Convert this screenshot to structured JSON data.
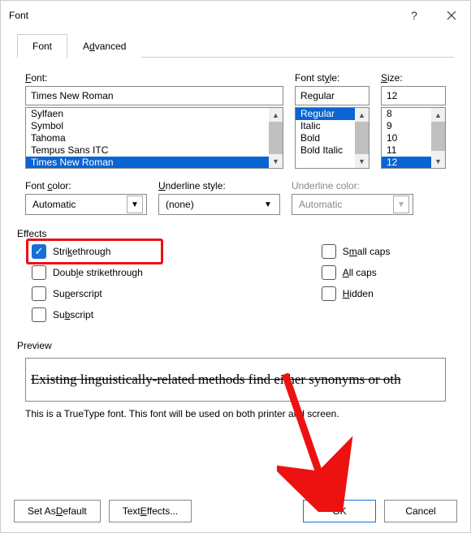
{
  "window": {
    "title": "Font"
  },
  "tabs": {
    "font": "Font",
    "advanced": "Advanced"
  },
  "labels": {
    "font": "Font:",
    "style": "Font style:",
    "size": "Size:",
    "fontColor": "Font color:",
    "underlineStyle": "Underline style:",
    "underlineColor": "Underline color:",
    "effects": "Effects",
    "preview": "Preview"
  },
  "font": {
    "value": "Times New Roman",
    "list": [
      "Sylfaen",
      "Symbol",
      "Tahoma",
      "Tempus Sans ITC",
      "Times New Roman"
    ],
    "selected": "Times New Roman"
  },
  "style": {
    "value": "Regular",
    "list": [
      "Regular",
      "Italic",
      "Bold",
      "Bold Italic"
    ],
    "selected": "Regular"
  },
  "size": {
    "value": "12",
    "list": [
      "8",
      "9",
      "10",
      "11",
      "12"
    ],
    "selected": "12"
  },
  "combos": {
    "fontColor": "Automatic",
    "underlineStyle": "(none)",
    "underlineColor": "Automatic"
  },
  "effects": {
    "strikethrough": "Strikethrough",
    "doubleStrike": "Double strikethrough",
    "superscript": "Superscript",
    "subscript": "Subscript",
    "smallCaps": "Small caps",
    "allCaps": "All caps",
    "hidden": "Hidden"
  },
  "preview": {
    "text": "Existing linguistically-related methods find either synonyms or oth",
    "desc": "This is a TrueType font. This font will be used on both printer and screen."
  },
  "buttons": {
    "setDefault": "Set As Default",
    "textEffects": "Text Effects...",
    "ok": "OK",
    "cancel": "Cancel"
  }
}
